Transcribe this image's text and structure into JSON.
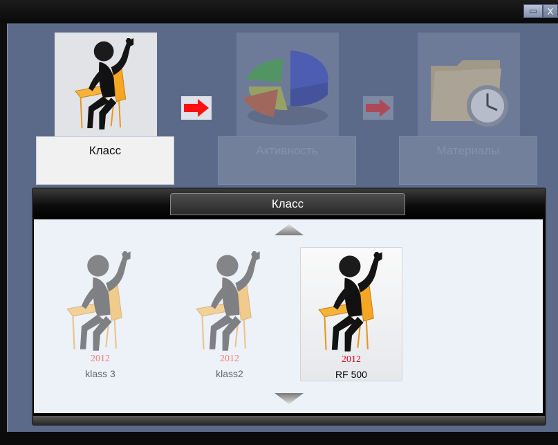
{
  "steps": [
    {
      "label": "Класс",
      "icon": "student-desk-icon",
      "active": true
    },
    {
      "label": "Активность",
      "icon": "pie-chart-icon",
      "active": false
    },
    {
      "label": "Материалы",
      "icon": "folder-clock-icon",
      "active": false
    }
  ],
  "panel": {
    "title": "Класс",
    "items": [
      {
        "year": "2012",
        "name": "klass 3",
        "selected": false
      },
      {
        "year": "2012",
        "name": "klass2",
        "selected": false
      },
      {
        "year": "2012",
        "name": "RF 500",
        "selected": true
      }
    ]
  },
  "window": {
    "minimize": "▭",
    "close": "X"
  },
  "colors": {
    "accent_red": "#e2001a",
    "faded_red": "#f07a7a",
    "frame": "#5c6a89"
  }
}
